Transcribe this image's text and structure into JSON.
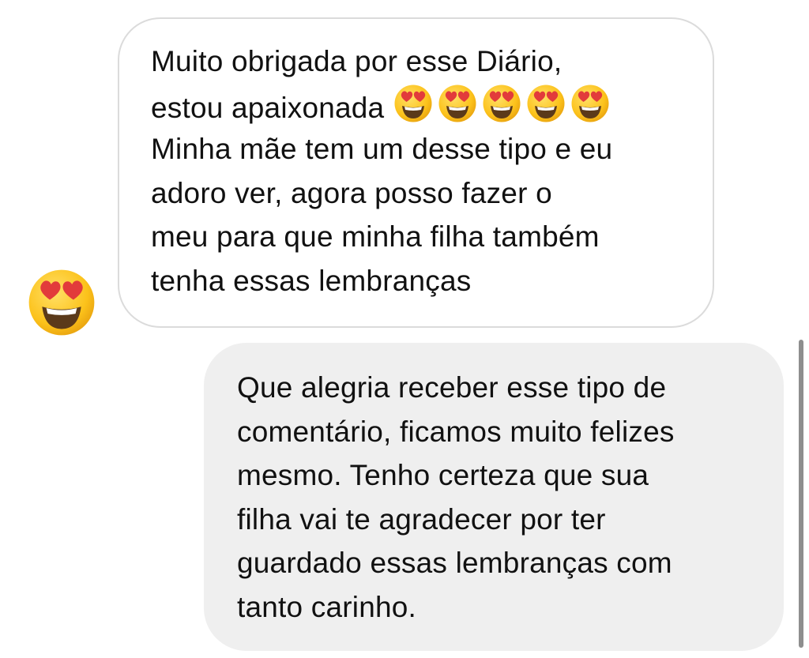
{
  "conversation": {
    "incoming": {
      "lines": [
        "Muito obrigada por esse Diário,",
        "estou apaixonada",
        "Minha mãe tem um desse tipo e eu",
        "adoro ver, agora posso fazer o",
        "meu para que minha filha também",
        "tenha essas lembranças"
      ],
      "inline_emoji": "heart-eyes-emoji",
      "inline_emoji_count": 5,
      "reaction_emoji": "heart-eyes-emoji"
    },
    "outgoing": {
      "lines": [
        "Que alegria receber esse tipo de",
        "comentário, ficamos muito felizes",
        "mesmo. Tenho certeza que sua",
        "filha vai te agradecer por ter",
        "guardado essas lembranças com",
        "tanto carinho."
      ]
    }
  },
  "colors": {
    "incoming_bubble_border": "#dbdbdb",
    "outgoing_bubble_bg": "#efefef",
    "text": "#111111",
    "emoji_face": "#fcc21b",
    "emoji_heart": "#e23b3b"
  }
}
